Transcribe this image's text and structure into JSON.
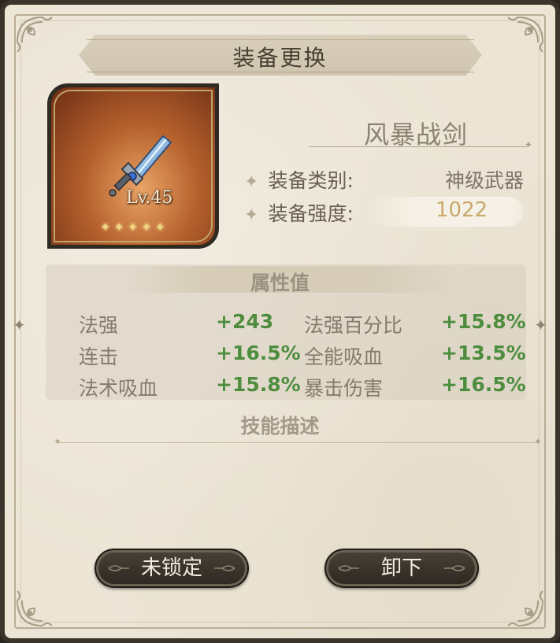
{
  "window": {
    "title": "装备更换"
  },
  "item": {
    "name": "风暴战剑",
    "level_label": "Lv.45",
    "stars": "✦✦✦✦✦",
    "star_count": 5,
    "icon": "crystal-sword-icon",
    "category_label": "装备类别:",
    "category_value": "神级武器",
    "strength_label": "装备强度:",
    "strength_value": "1022"
  },
  "attributes": {
    "title": "属性值",
    "rows": [
      {
        "left_name": "法强",
        "left_value": "+243",
        "right_name": "法强百分比",
        "right_value": "+15.8%"
      },
      {
        "left_name": "连击",
        "left_value": "+16.5%",
        "right_name": "全能吸血",
        "right_value": "+13.5%"
      },
      {
        "left_name": "法术吸血",
        "left_value": "+15.8%",
        "right_name": "暴击伤害",
        "right_value": "+16.5%"
      }
    ]
  },
  "skill": {
    "title": "技能描述"
  },
  "buttons": {
    "lock_label": "未锁定",
    "unequip_label": "卸下"
  },
  "colors": {
    "parchment": "#ece5d6",
    "frame": "#3a342b",
    "stat_green": "#4e8d3f",
    "strength_gold": "#c9a86a"
  }
}
